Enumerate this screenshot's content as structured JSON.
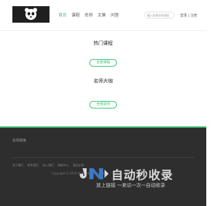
{
  "header": {
    "nav": [
      "首页",
      "课程",
      "名师",
      "文章",
      "问答"
    ],
    "search_placeholder": "输入你想学的课程",
    "login": "登录 | 注册"
  },
  "sections": [
    {
      "title": "热门课程",
      "button": "全部课程"
    },
    {
      "title": "名师大咖",
      "button": "全部讲师"
    }
  ],
  "footer": {
    "title": "友情链接",
    "links": [
      "关于我们",
      "联系我们",
      "加入我们",
      "帮助中心",
      "意见反馈"
    ],
    "copyright": "Copyright © 2019 All Rights Reserved"
  },
  "watermark": {
    "title": "自动秒收录",
    "subtitle": "放上链接 一来访一次一自动收录"
  },
  "colors": {
    "accent": "#3cc37a",
    "footer_bg": "#2e2e2e"
  }
}
